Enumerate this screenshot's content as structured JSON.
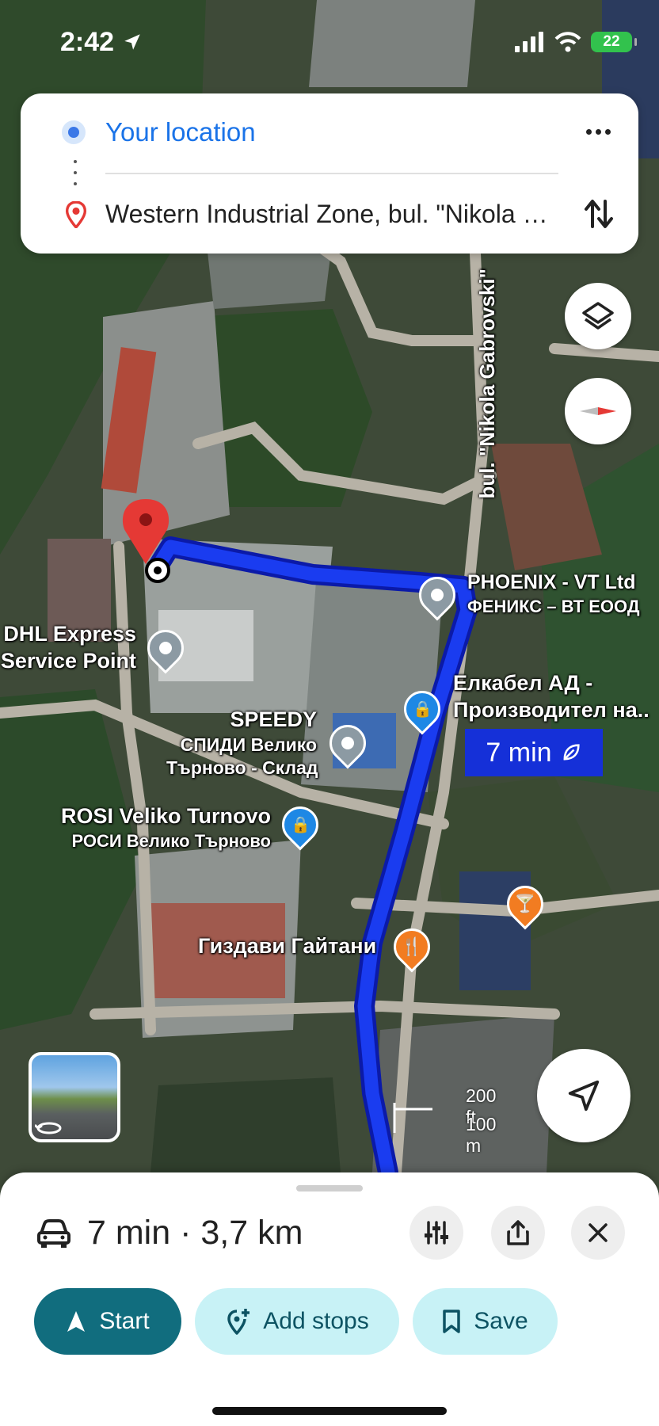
{
  "status_bar": {
    "time": "2:42",
    "battery": "22"
  },
  "directions": {
    "origin": "Your location",
    "destination": "Western Industrial Zone, bul. \"Nikola Gabrovski\"",
    "more_icon": "more-horiz-icon",
    "swap_icon": "swap-vertical-icon"
  },
  "map": {
    "street_label": "bul. \"Nikola Gabrovski\"",
    "places": [
      {
        "name": "PHOENIX - VT Ltd",
        "sub": "ФЕНИКС – ВТ ЕООД"
      },
      {
        "name": "DHL Express",
        "sub": "Service Point"
      },
      {
        "name": "Елкабел АД -",
        "sub": "Производител на.."
      },
      {
        "name": "SPEEDY",
        "sub": "СПИДИ Велико",
        "sub2": "Търново - Склад"
      },
      {
        "name": "ROSI Veliko Turnovo",
        "sub": "РОСИ Велико Търново"
      },
      {
        "name": "Гиздави Гайтани"
      }
    ],
    "route_duration": "7 min",
    "scale": {
      "imperial": "200 ft",
      "metric": "100 m"
    }
  },
  "sheet": {
    "summary": "7 min · 3,7 km",
    "mode_icon": "car-icon",
    "buttons": {
      "start": "Start",
      "add_stops": "Add stops",
      "save": "Save"
    }
  },
  "colors": {
    "route": "#1a3cf0",
    "accent": "#1a73e8",
    "start_button": "#116d7e",
    "pill_light": "#c8f2f6"
  }
}
